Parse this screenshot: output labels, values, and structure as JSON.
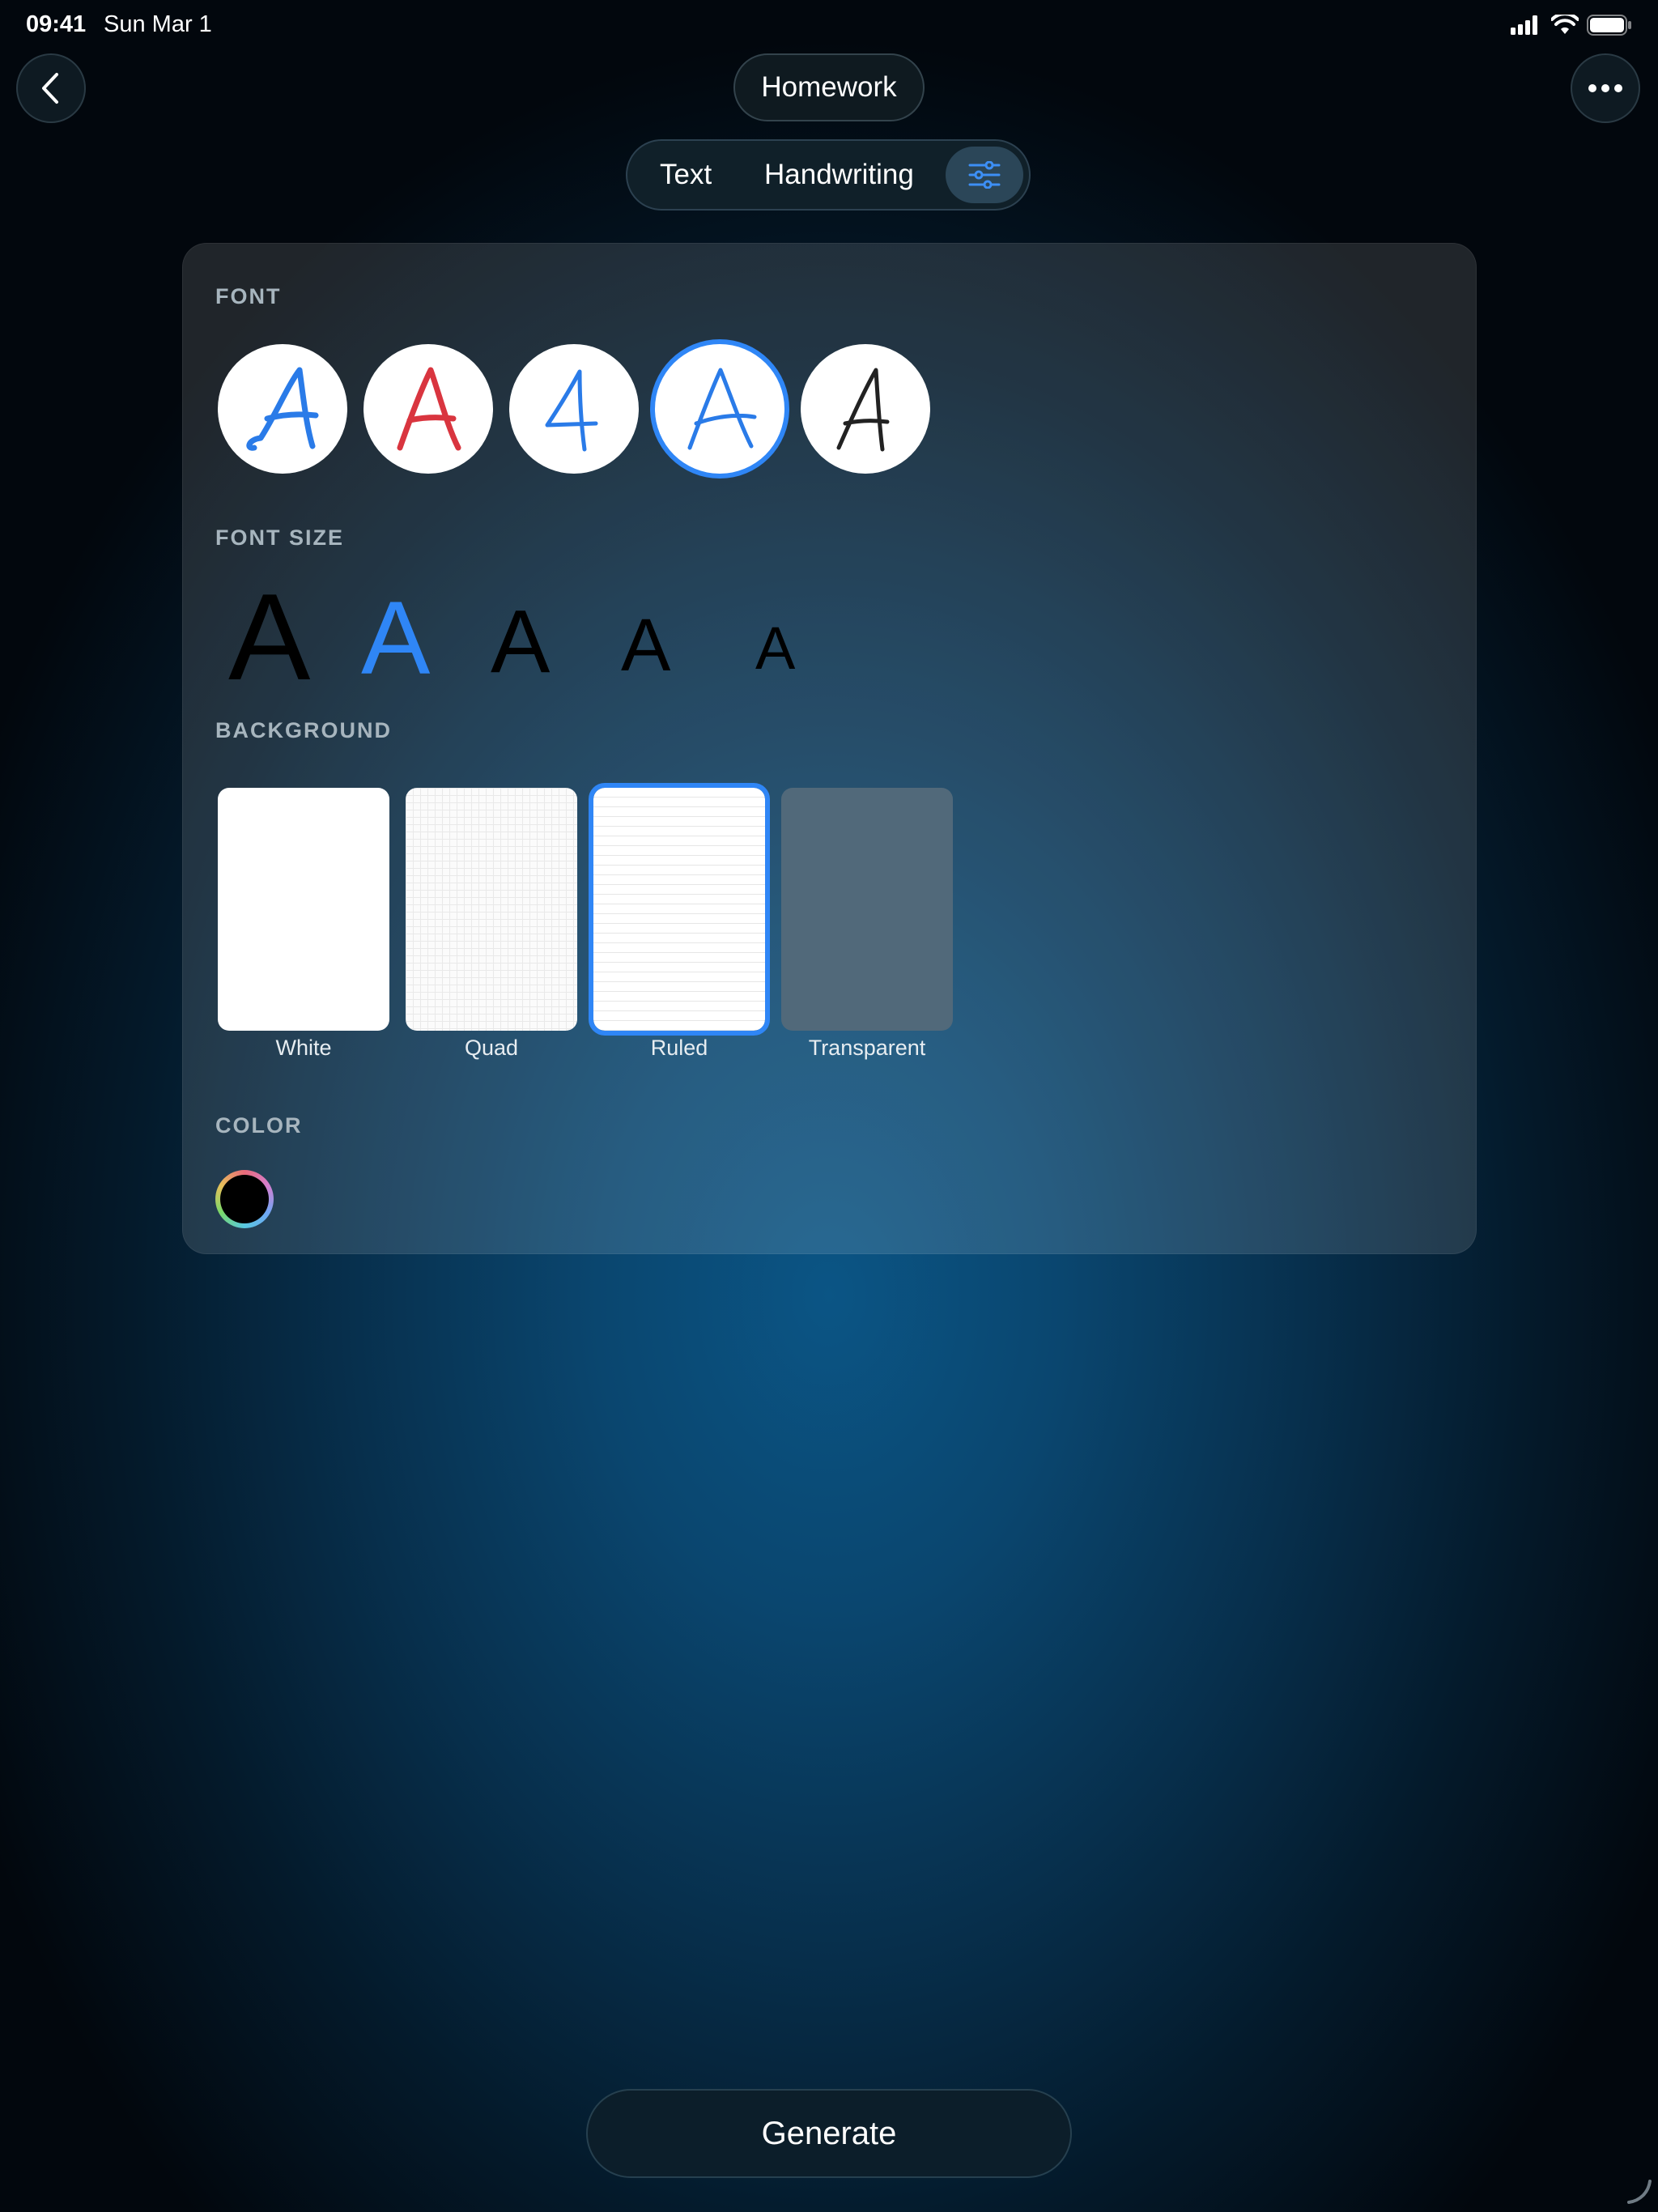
{
  "status_bar": {
    "time": "09:41",
    "date": "Sun Mar 1"
  },
  "header": {
    "title": "Homework"
  },
  "segment": {
    "text_label": "Text",
    "handwriting_label": "Handwriting",
    "selected": "settings"
  },
  "panel": {
    "font": {
      "label": "FONT",
      "options": [
        {
          "glyph": "A",
          "color": "#2a7be8"
        },
        {
          "glyph": "A",
          "color": "#d9353f"
        },
        {
          "glyph": "A",
          "color": "#2a7be8"
        },
        {
          "glyph": "A",
          "color": "#2a7be8"
        },
        {
          "glyph": "A",
          "color": "#222222"
        }
      ],
      "selected_index": 3
    },
    "font_size": {
      "label": "FONT SIZE",
      "options": [
        {
          "glyph": "A",
          "color": "#000000"
        },
        {
          "glyph": "A",
          "color": "#2f86f6"
        },
        {
          "glyph": "A",
          "color": "#000000"
        },
        {
          "glyph": "A",
          "color": "#000000"
        },
        {
          "glyph": "A",
          "color": "#000000"
        }
      ],
      "selected_index": 1
    },
    "background": {
      "label": "BACKGROUND",
      "options": [
        {
          "label": "White"
        },
        {
          "label": "Quad"
        },
        {
          "label": "Ruled"
        },
        {
          "label": "Transparent"
        }
      ],
      "selected_index": 2
    },
    "color": {
      "label": "COLOR",
      "current": "#000000"
    }
  },
  "generate": {
    "label": "Generate"
  },
  "colors": {
    "accent": "#2f86f6"
  }
}
